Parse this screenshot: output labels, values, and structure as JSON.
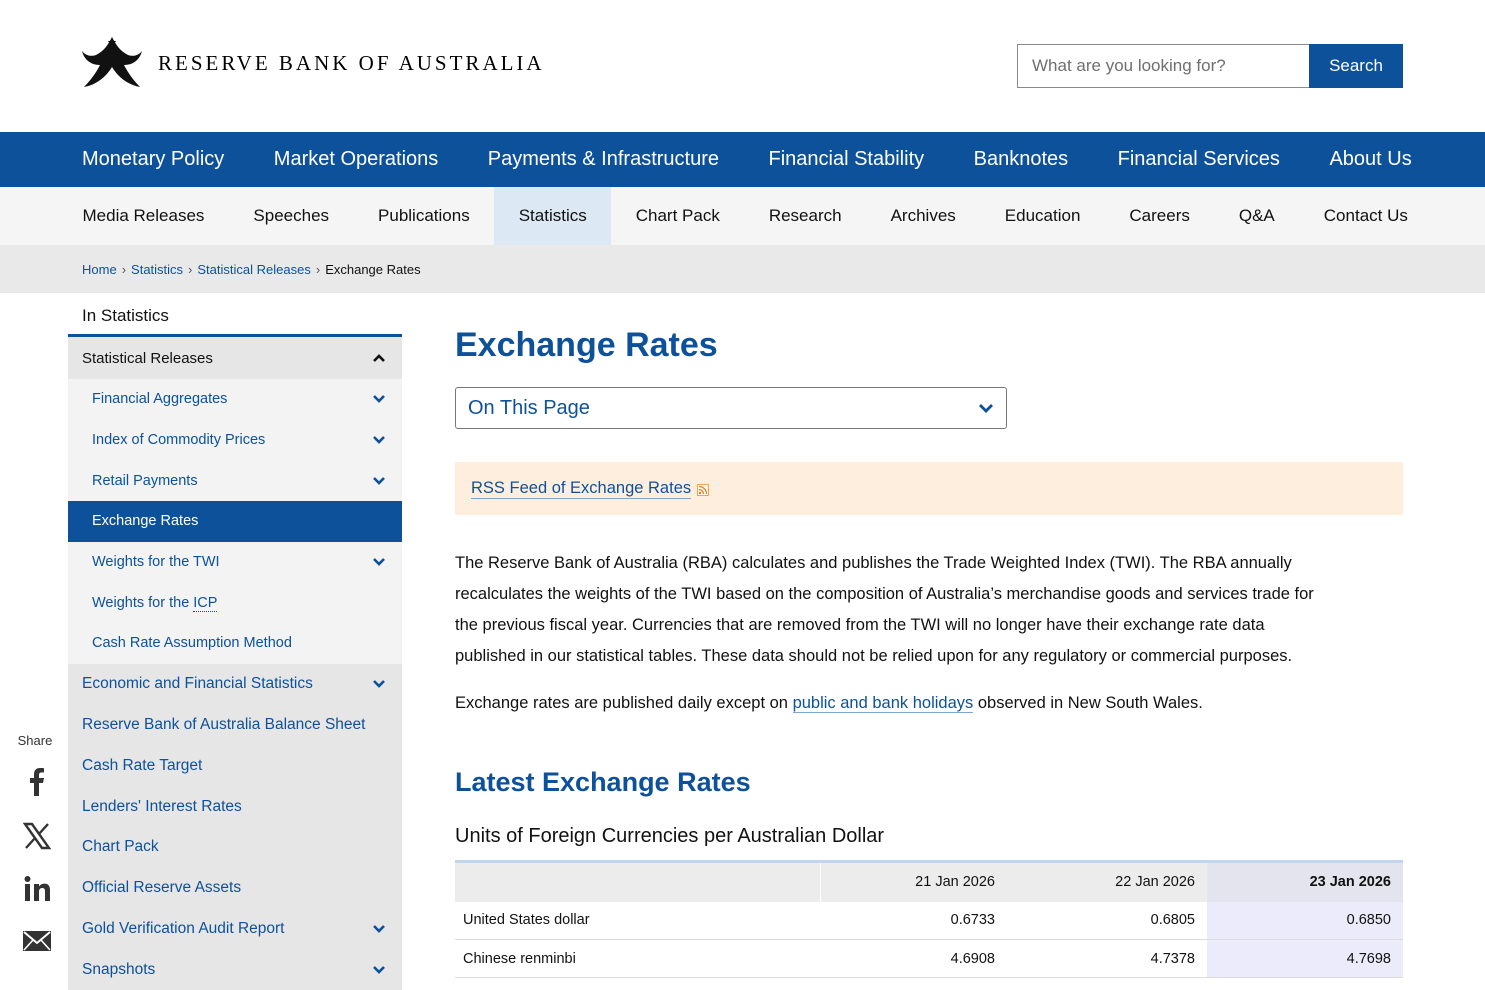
{
  "header": {
    "org_name": "RESERVE BANK OF AUSTRALIA",
    "search_placeholder": "What are you looking for?",
    "search_button": "Search"
  },
  "primary_nav": [
    "Monetary Policy",
    "Market Operations",
    "Payments & Infrastructure",
    "Financial Stability",
    "Banknotes",
    "Financial Services",
    "About Us"
  ],
  "secondary_nav": {
    "items": [
      "Media Releases",
      "Speeches",
      "Publications",
      "Statistics",
      "Chart Pack",
      "Research",
      "Archives",
      "Education",
      "Careers",
      "Q&A",
      "Contact Us"
    ],
    "active": "Statistics"
  },
  "breadcrumb": {
    "items": [
      "Home",
      "Statistics",
      "Statistical Releases"
    ],
    "current": "Exchange Rates",
    "separator": "›"
  },
  "sidebar": {
    "heading": "In Statistics",
    "group_label": "Statistical Releases",
    "sub_items": [
      {
        "label": "Financial Aggregates",
        "expandable": true
      },
      {
        "label": "Index of Commodity Prices",
        "expandable": true
      },
      {
        "label": "Retail Payments",
        "expandable": true
      },
      {
        "label": "Exchange Rates",
        "active": true
      },
      {
        "label": "Weights for the TWI",
        "expandable": true
      },
      {
        "label_prefix": "Weights for the ",
        "label_abbr": "ICP"
      },
      {
        "label": "Cash Rate Assumption Method"
      }
    ],
    "top_items": [
      {
        "label": "Economic and Financial Statistics",
        "expandable": true
      },
      {
        "label": "Reserve Bank of Australia Balance Sheet"
      },
      {
        "label": "Cash Rate Target"
      },
      {
        "label": "Lenders' Interest Rates"
      },
      {
        "label": "Chart Pack"
      },
      {
        "label": "Official Reserve Assets"
      },
      {
        "label": "Gold Verification Audit Report",
        "expandable": true
      },
      {
        "label": "Snapshots",
        "expandable": true
      }
    ]
  },
  "share": {
    "label": "Share",
    "icons": [
      "facebook-icon",
      "x-icon",
      "linkedin-icon",
      "email-icon"
    ]
  },
  "main": {
    "title": "Exchange Rates",
    "on_this_page": "On This Page",
    "rss_link": "RSS Feed of Exchange Rates",
    "paragraph1": "The Reserve Bank of Australia (RBA) calculates and publishes the Trade Weighted Index (TWI). The RBA annually recalculates the weights of the TWI based on the composition of Australia’s merchandise goods and services trade for the previous fiscal year. Currencies that are removed from the TWI will no longer have their exchange rate data published in our statistical tables. These data should not be relied upon for any regulatory or commercial purposes.",
    "paragraph2_before": "Exchange rates are published daily except on ",
    "paragraph2_link": "public and bank holidays",
    "paragraph2_after": " observed in New South Wales.",
    "section_title": "Latest Exchange Rates",
    "table_caption": "Units of Foreign Currencies per Australian Dollar",
    "table": {
      "headers": [
        "",
        "21 Jan 2026",
        "22 Jan 2026",
        "23 Jan 2026"
      ],
      "rows": [
        [
          "United States dollar",
          "0.6733",
          "0.6805",
          "0.6850"
        ],
        [
          "Chinese renminbi",
          "4.6908",
          "4.7378",
          "4.7698"
        ]
      ]
    }
  },
  "colors": {
    "brand_blue": "#0d519a",
    "rss_background": "#fdeede",
    "nav_active": "#dce8f4"
  }
}
